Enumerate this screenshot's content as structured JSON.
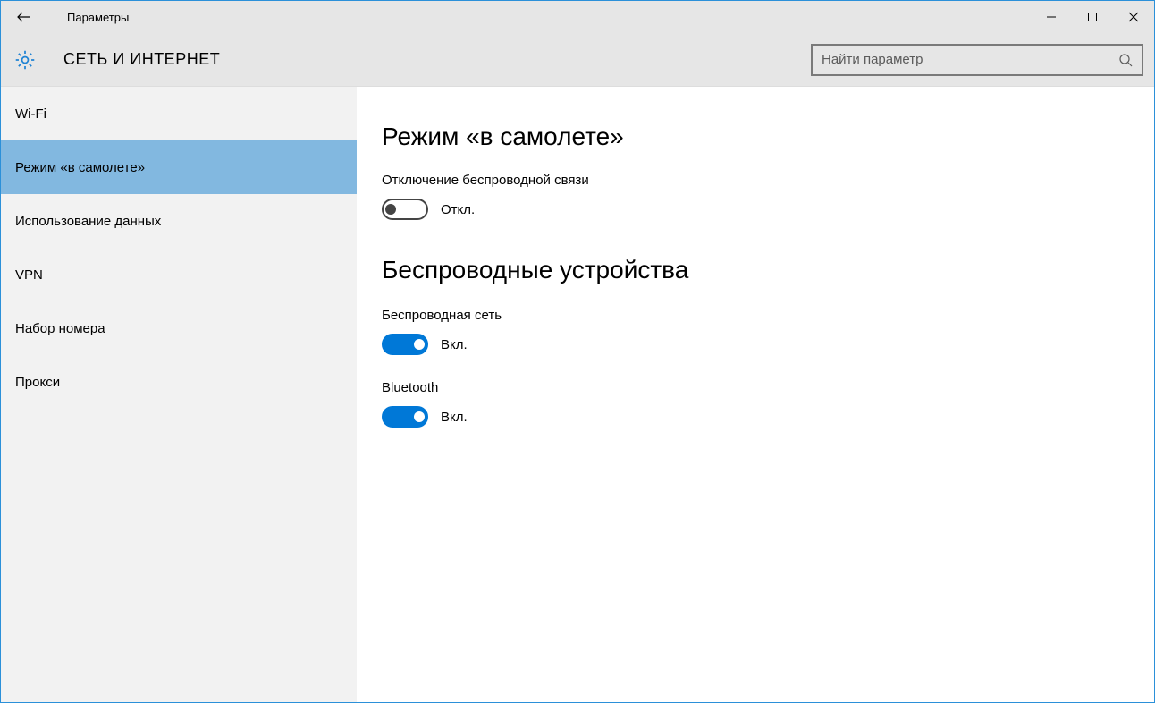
{
  "window": {
    "title": "Параметры"
  },
  "header": {
    "heading": "СЕТЬ И ИНТЕРНЕТ",
    "search_placeholder": "Найти параметр"
  },
  "sidebar": {
    "items": [
      {
        "label": "Wi-Fi"
      },
      {
        "label": "Режим «в самолете»"
      },
      {
        "label": "Использование данных"
      },
      {
        "label": "VPN"
      },
      {
        "label": "Набор номера"
      },
      {
        "label": "Прокси"
      }
    ],
    "selected_index": 1
  },
  "main": {
    "section1": {
      "title": "Режим «в самолете»",
      "desc": "Отключение беспроводной связи",
      "toggle_state": "Откл."
    },
    "section2": {
      "title": "Беспроводные устройства",
      "wifi_label": "Беспроводная сеть",
      "wifi_state": "Вкл.",
      "bt_label": "Bluetooth",
      "bt_state": "Вкл."
    }
  }
}
